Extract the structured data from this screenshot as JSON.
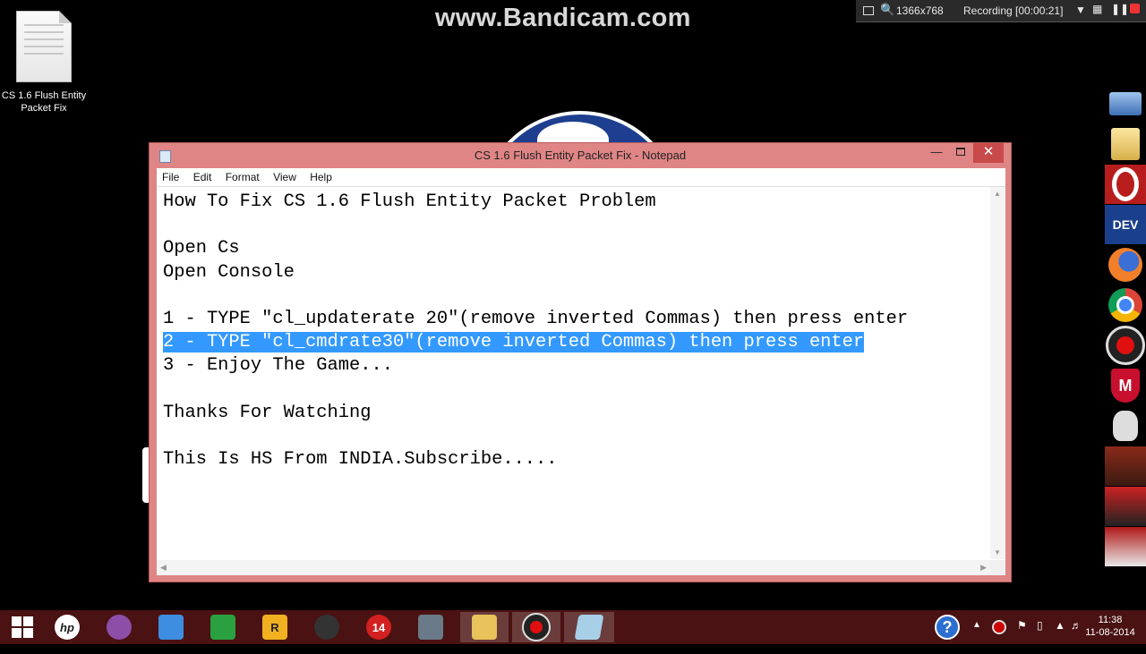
{
  "watermark": "www.Bandicam.com",
  "bandicam": {
    "resolution": "1366x768",
    "status": "Recording [00:00:21]"
  },
  "desktop": {
    "icon_label": "CS 1.6 Flush Entity Packet Fix"
  },
  "window": {
    "title": "CS 1.6 Flush Entity Packet Fix - Notepad",
    "menu": [
      "File",
      "Edit",
      "Format",
      "View",
      "Help"
    ],
    "lines": [
      "How To Fix CS 1.6 Flush Entity Packet Problem",
      "",
      "Open Cs",
      "Open Console",
      "",
      "1 - TYPE \"cl_updaterate 20\"(remove inverted Commas) then press enter",
      "2 - TYPE \"cl_cmdrate30\"(remove inverted Commas) then press enter",
      "3 - Enjoy The Game...",
      "",
      "Thanks For Watching",
      "",
      "This Is HS From INDIA.Subscribe....."
    ],
    "selected_line_index": 6
  },
  "dock": [
    {
      "icon": "computer-icon"
    },
    {
      "icon": "folder-icon"
    },
    {
      "icon": "opera-icon"
    },
    {
      "icon": "devcpp-icon",
      "text": "DEV"
    },
    {
      "icon": "firefox-icon"
    },
    {
      "icon": "chrome-icon"
    },
    {
      "icon": "record-icon"
    },
    {
      "icon": "mcafee-icon",
      "text": "M"
    },
    {
      "icon": "ghost-skull-icon"
    },
    {
      "icon": "maxpayne-icon"
    },
    {
      "icon": "racing-game-icon"
    },
    {
      "icon": "dmc-icon"
    }
  ],
  "taskbar": {
    "items": [
      "windows-start-icon",
      "hp-icon",
      "bittorrent-icon",
      "network-icon",
      "store-icon",
      "rockstar-icon",
      "ninja-icon",
      "pdf-14-icon",
      "counterstrike-icon",
      "file-explorer-icon",
      "bandicam-icon",
      "notepad-icon"
    ],
    "rockstar_text": "R",
    "badge_14": "14",
    "clock_time": "11:38",
    "clock_date": "11-08-2014"
  }
}
